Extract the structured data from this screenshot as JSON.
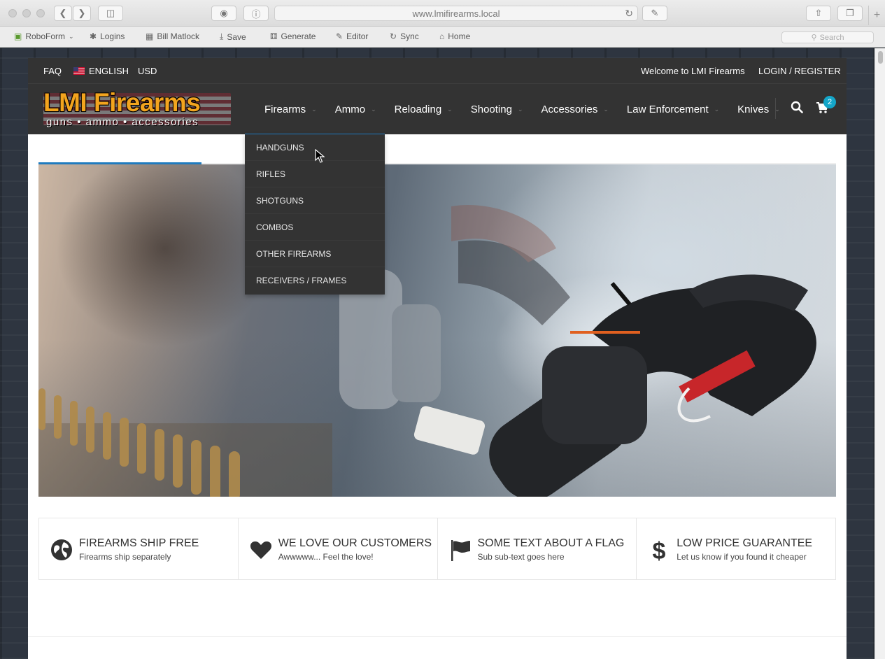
{
  "browser": {
    "url": "www.lmifirearms.local",
    "bookmarks": [
      "RoboForm",
      "Logins",
      "Bill Matlock",
      "Save",
      "Generate",
      "Editor",
      "Sync",
      "Home"
    ],
    "search_placeholder": "Search"
  },
  "topbar": {
    "faq": "FAQ",
    "language": "ENGLISH",
    "currency": "USD",
    "welcome": "Welcome to LMI Firearms",
    "login": "LOGIN / REGISTER"
  },
  "logo": {
    "name": "LMI Firearms",
    "tagline": "guns • ammo • accessories"
  },
  "nav": {
    "items": [
      "Firearms",
      "Ammo",
      "Reloading",
      "Shooting",
      "Accessories",
      "Law Enforcement",
      "Knives"
    ],
    "cart_count": "2"
  },
  "dropdown": {
    "items": [
      "HANDGUNS",
      "RIFLES",
      "SHOTGUNS",
      "COMBOS",
      "OTHER FIREARMS",
      "RECEIVERS / FRAMES"
    ]
  },
  "features": [
    {
      "icon": "globe-icon",
      "title": "FIREARMS SHIP FREE",
      "sub": "Firearms ship separately"
    },
    {
      "icon": "heart-icon",
      "title": "WE LOVE OUR CUSTOMERS",
      "sub": "Awwwww... Feel the love!"
    },
    {
      "icon": "flag-icon",
      "title": "SOME TEXT ABOUT A FLAG",
      "sub": "Sub sub-text goes here"
    },
    {
      "icon": "dollar-icon",
      "title": "LOW PRICE GUARANTEE",
      "sub": "Let us know if you found it cheaper"
    }
  ],
  "colors": {
    "accent": "#1f7bbf",
    "badge": "#14a6c9",
    "logo": "#f3a41e",
    "bar": "#333333"
  }
}
